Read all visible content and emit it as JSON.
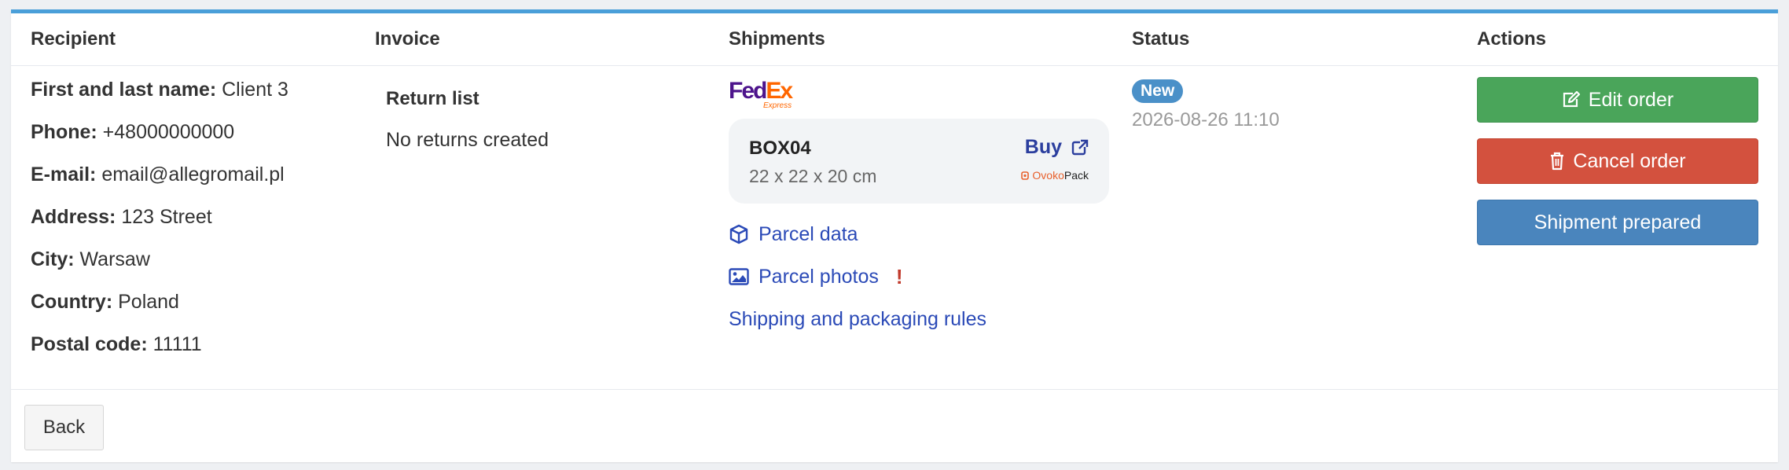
{
  "table": {
    "headers": [
      "Recipient",
      "Invoice",
      "Shipments",
      "Status",
      "Actions"
    ]
  },
  "recipient": [
    {
      "label": "First and last name:",
      "value": "Client 3"
    },
    {
      "label": "Phone:",
      "value": "+48000000000"
    },
    {
      "label": "E-mail:",
      "value": "email@allegromail.pl"
    },
    {
      "label": "Address:",
      "value": "123 Street"
    },
    {
      "label": "City:",
      "value": "Warsaw"
    },
    {
      "label": "Country:",
      "value": "Poland"
    },
    {
      "label": "Postal code:",
      "value": "11111"
    }
  ],
  "invoice": {
    "title": "Return list",
    "text": "No returns created"
  },
  "shipment": {
    "carrier_fe": "Fed",
    "carrier_ex": "Ex",
    "carrier_sub": "Express",
    "box_name": "BOX04",
    "box_dimensions": "22 x 22 x 20 cm",
    "buy_label": "Buy",
    "partner_a": "Ovoko",
    "partner_b": "Pack",
    "parcel_data": "Parcel data",
    "parcel_photos": "Parcel photos",
    "photos_alert": "!",
    "rules_link": "Shipping and packaging rules"
  },
  "status": {
    "badge": "New",
    "date": "2026-08-26 11:10"
  },
  "actions": {
    "edit": "Edit order",
    "cancel": "Cancel order",
    "prepared": "Shipment prepared"
  },
  "footer": {
    "back": "Back"
  },
  "colors": {
    "accent_top": "#4a9fd9",
    "link": "#2b4ab7",
    "green": "#4aa55a",
    "red": "#d3513e",
    "blue": "#4a85bd",
    "badge": "#4a90c8"
  },
  "icons": [
    "edit-icon",
    "trash-icon",
    "external-link-icon",
    "box-icon",
    "image-icon"
  ]
}
